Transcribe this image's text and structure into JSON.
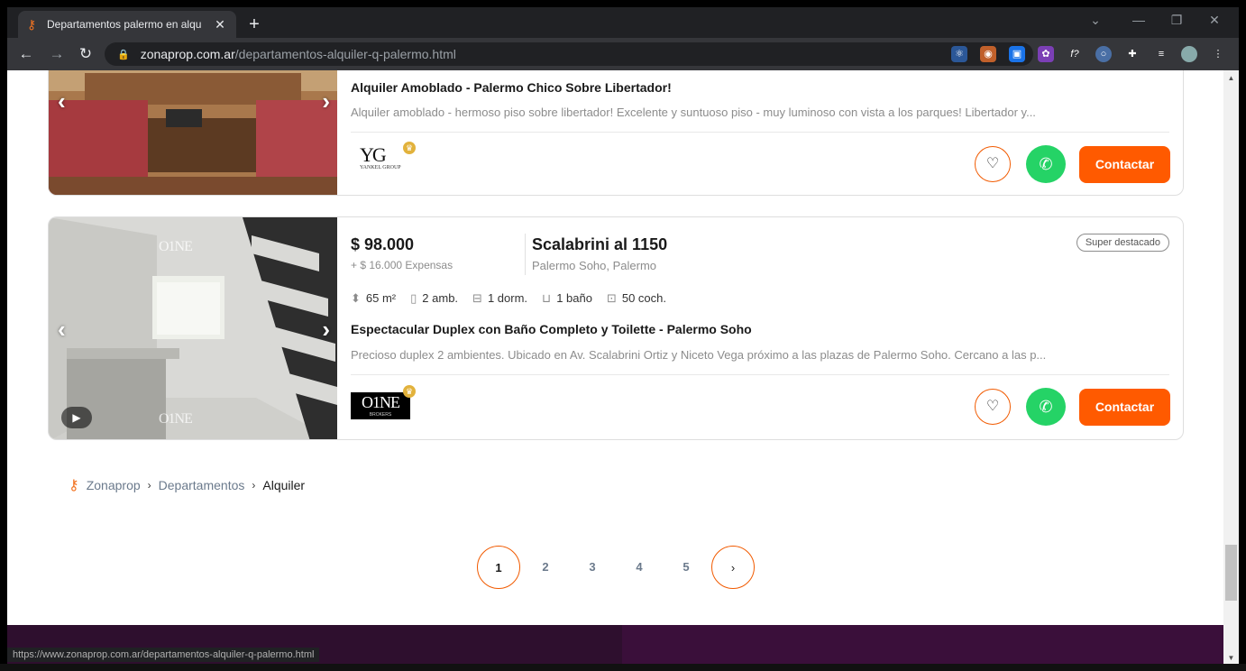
{
  "browser": {
    "tab_title": "Departamentos palermo en alqu",
    "url_host": "zonaprop.com.ar",
    "url_path": "/departamentos-alquiler-q-palermo.html",
    "status_url": "https://www.zonaprop.com.ar/departamentos-alquiler-q-palermo.html"
  },
  "listings": [
    {
      "title": "Alquiler Amoblado - Palermo Chico Sobre Libertador!",
      "description": "Alquiler amoblado - hermoso piso sobre libertador! Excelente y suntuoso piso - muy luminoso con vista a los parques! Libertador y...",
      "agency_logo_text": "YG",
      "agency_logo_sub": "YANKEL GROUP",
      "contact_label": "Contactar"
    },
    {
      "price": "$ 98.000",
      "expensas": "+ $ 16.000 Expensas",
      "address": "Scalabrini al 1150",
      "location": "Palermo Soho, Palermo",
      "badge": "Super destacado",
      "features": {
        "area": "65 m²",
        "ambientes": "2 amb.",
        "dormitorios": "1 dorm.",
        "banos": "1 baño",
        "cocheras": "50 coch."
      },
      "title": "Espectacular Duplex con Baño Completo y Toilette - Palermo Soho",
      "description": "Precioso duplex 2 ambientes.  Ubicado en Av. Scalabrini Ortiz y Niceto Vega próximo a las plazas de Palermo Soho. Cercano a las p...",
      "agency_logo_text": "O1NE",
      "agency_logo_sub": "BROKERS",
      "photo_watermark": "O1NE",
      "contact_label": "Contactar"
    }
  ],
  "breadcrumb": [
    "Zonaprop",
    "Departamentos",
    "Alquiler"
  ],
  "pagination": {
    "pages": [
      "1",
      "2",
      "3",
      "4",
      "5"
    ],
    "current": "1"
  },
  "colors": {
    "accent": "#ff5a00",
    "whatsapp": "#25d366",
    "footer": "#2e0f2e"
  }
}
